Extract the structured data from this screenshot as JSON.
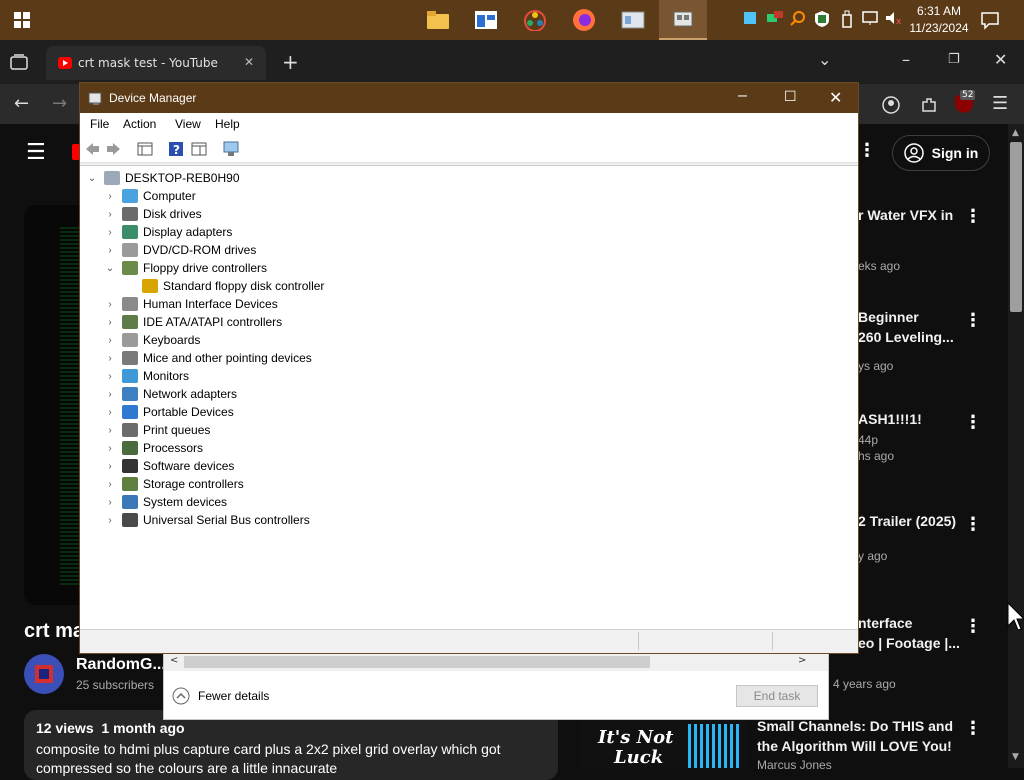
{
  "taskbar": {
    "clock_time": "6:31 AM",
    "clock_date": "11/23/2024",
    "notification_badge": "52",
    "colors": {
      "bar": "#5b3a17",
      "active": "#7a5532"
    }
  },
  "browser": {
    "tab_title": "crt mask test - YouTube"
  },
  "youtube": {
    "sign_in": "Sign in",
    "video_title": "crt ma",
    "channel_name": "RandomG...",
    "subscribers": "25 subscribers",
    "views": "12 views",
    "posted": "1 month ago",
    "description_line1": "composite to hdmi plus capture card plus a 2x2 pixel grid overlay which got",
    "description_line2": "compressed so the colours are a little innacurate",
    "recommendations": [
      {
        "title_line1": "r Water VFX in",
        "title_line2": "",
        "meta1": "",
        "meta2": "eks ago"
      },
      {
        "title_line1": "Beginner",
        "title_line2": "260 Leveling...",
        "meta1": "",
        "meta2": "ys ago"
      },
      {
        "title_line1": "ASH1!!!1!",
        "title_line2": "",
        "meta1": "44p",
        "meta2": "hs ago"
      },
      {
        "title_line1": "2 Trailer (2025)",
        "title_line2": "",
        "meta1": "",
        "meta2": "y ago"
      },
      {
        "title_line1": "nterface",
        "title_line2": "eo | Footage |...",
        "meta1": "",
        "meta2": "4 years ago"
      },
      {
        "title_line1": "Small Channels: Do THIS and",
        "title_line2": "the Algorithm Will LOVE You!",
        "meta1": "Marcus Jones",
        "meta2": ""
      }
    ],
    "thumb_text_line1": "It's Not",
    "thumb_text_line2": "Luck"
  },
  "device_manager": {
    "title": "Device Manager",
    "menu": [
      "File",
      "Action",
      "View",
      "Help"
    ],
    "root": "DESKTOP-REB0H90",
    "nodes": [
      {
        "label": "Computer",
        "icon": "computer-icon",
        "color": "#4aa3df"
      },
      {
        "label": "Disk drives",
        "icon": "disk-drive-icon",
        "color": "#6b6b6b"
      },
      {
        "label": "Display adapters",
        "icon": "display-adapter-icon",
        "color": "#3d8d6a"
      },
      {
        "label": "DVD/CD-ROM drives",
        "icon": "dvd-drive-icon",
        "color": "#9a9a9a"
      },
      {
        "label": "Floppy drive controllers",
        "icon": "floppy-controller-icon",
        "color": "#6a8c4a"
      },
      {
        "label": "Standard floppy disk controller",
        "icon": "warning-device-icon",
        "color": "#d8a400"
      },
      {
        "label": "Human Interface Devices",
        "icon": "hid-icon",
        "color": "#8a8a8a"
      },
      {
        "label": "IDE ATA/ATAPI controllers",
        "icon": "ide-controller-icon",
        "color": "#5c7c4a"
      },
      {
        "label": "Keyboards",
        "icon": "keyboard-icon",
        "color": "#9a9a9a"
      },
      {
        "label": "Mice and other pointing devices",
        "icon": "mouse-icon",
        "color": "#7a7a7a"
      },
      {
        "label": "Monitors",
        "icon": "monitor-icon",
        "color": "#3d9ad6"
      },
      {
        "label": "Network adapters",
        "icon": "network-adapter-icon",
        "color": "#3d7fc0"
      },
      {
        "label": "Portable Devices",
        "icon": "portable-device-icon",
        "color": "#2f7ad0"
      },
      {
        "label": "Print queues",
        "icon": "printer-icon",
        "color": "#6b6b6b"
      },
      {
        "label": "Processors",
        "icon": "processor-icon",
        "color": "#4c6b3c"
      },
      {
        "label": "Software devices",
        "icon": "software-device-icon",
        "color": "#333333"
      },
      {
        "label": "Storage controllers",
        "icon": "storage-controller-icon",
        "color": "#5e7f3e"
      },
      {
        "label": "System devices",
        "icon": "system-device-icon",
        "color": "#3c78b8"
      },
      {
        "label": "Universal Serial Bus controllers",
        "icon": "usb-icon",
        "color": "#4a4a4a"
      }
    ]
  },
  "task_manager": {
    "fewer_details": "Fewer details",
    "end_task": "End task"
  }
}
